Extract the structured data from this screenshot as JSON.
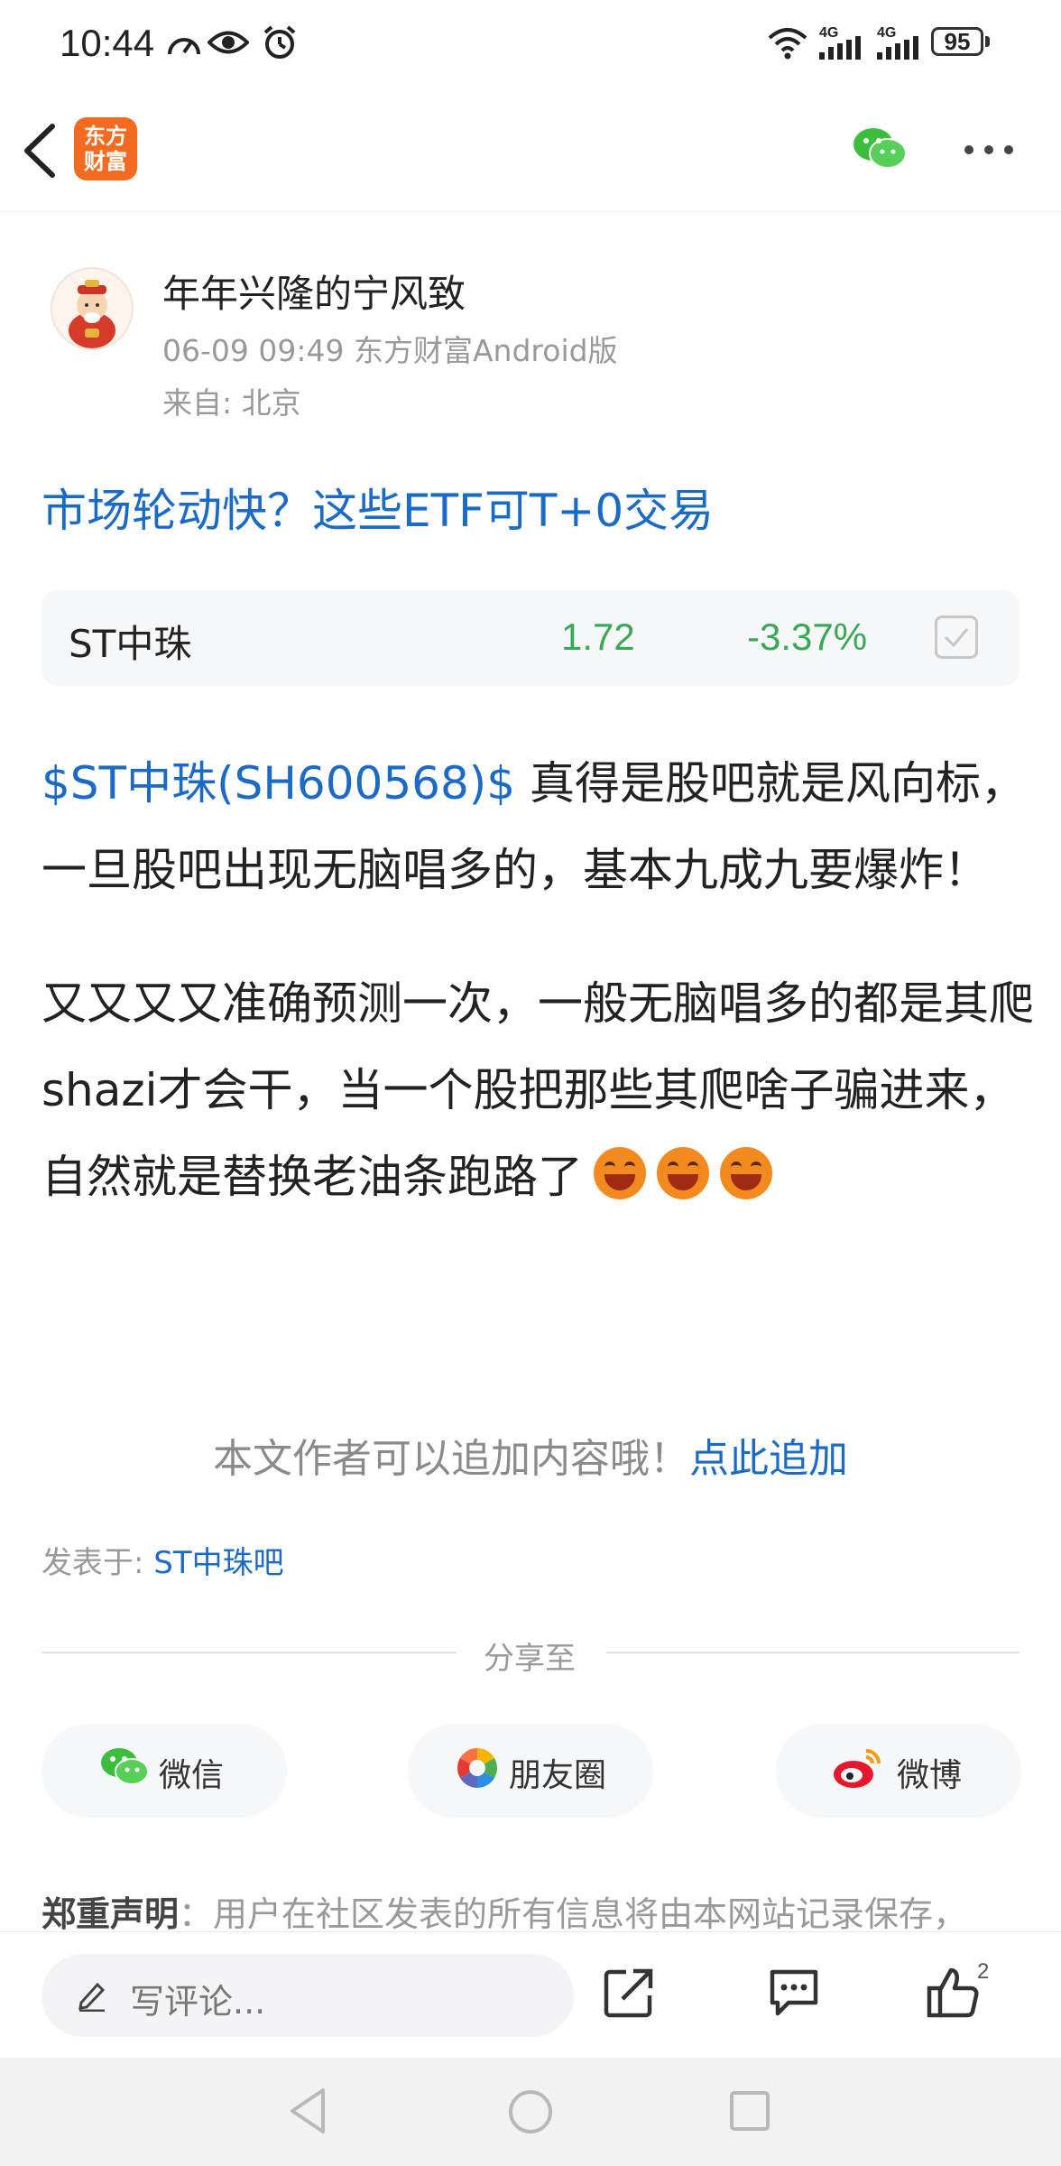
{
  "status_bar": {
    "time": "10:44",
    "network_1": "4G",
    "network_2": "4G",
    "battery": "95"
  },
  "header": {
    "logo_text_line1": "东方",
    "logo_text_line2": "财富",
    "icons": [
      "back-arrow-icon",
      "wechat-icon",
      "more-icon"
    ]
  },
  "author": {
    "name": "年年兴隆的宁风致",
    "meta": "06-09 09:49 东方财富Android版",
    "location": "来自: 北京"
  },
  "promo_title": "市场轮动快？这些ETF可T+0交易",
  "stock_card": {
    "name": "ST中珠",
    "price": "1.72",
    "change": "-3.37%",
    "color": "#3aa756"
  },
  "post": {
    "tag": "$ST中珠(SH600568)$",
    "para1_rest": " 真得是股吧就是风向标，一旦股吧出现无脑唱多的，基本九成九要爆炸！",
    "para2": "又又又又准确预测一次，一般无脑唱多的都是其爬shazi才会干，当一个股把那些其爬啥子骗进来，自然就是替换老油条跑路了"
  },
  "append": {
    "text": "本文作者可以追加内容哦！",
    "link": "点此追加"
  },
  "posted_in": {
    "label": "发表于: ",
    "bar": "ST中珠吧"
  },
  "share": {
    "title": "分享至",
    "wechat": "微信",
    "moments": "朋友圈",
    "weibo": "微博"
  },
  "disclaimer": {
    "label": "郑重声明",
    "text": "：用户在社区发表的所有信息将由本网站记录保存，"
  },
  "bottom_bar": {
    "comment_placeholder": "写评论...",
    "like_count": "2"
  },
  "accent_color": "#1b6bc6"
}
